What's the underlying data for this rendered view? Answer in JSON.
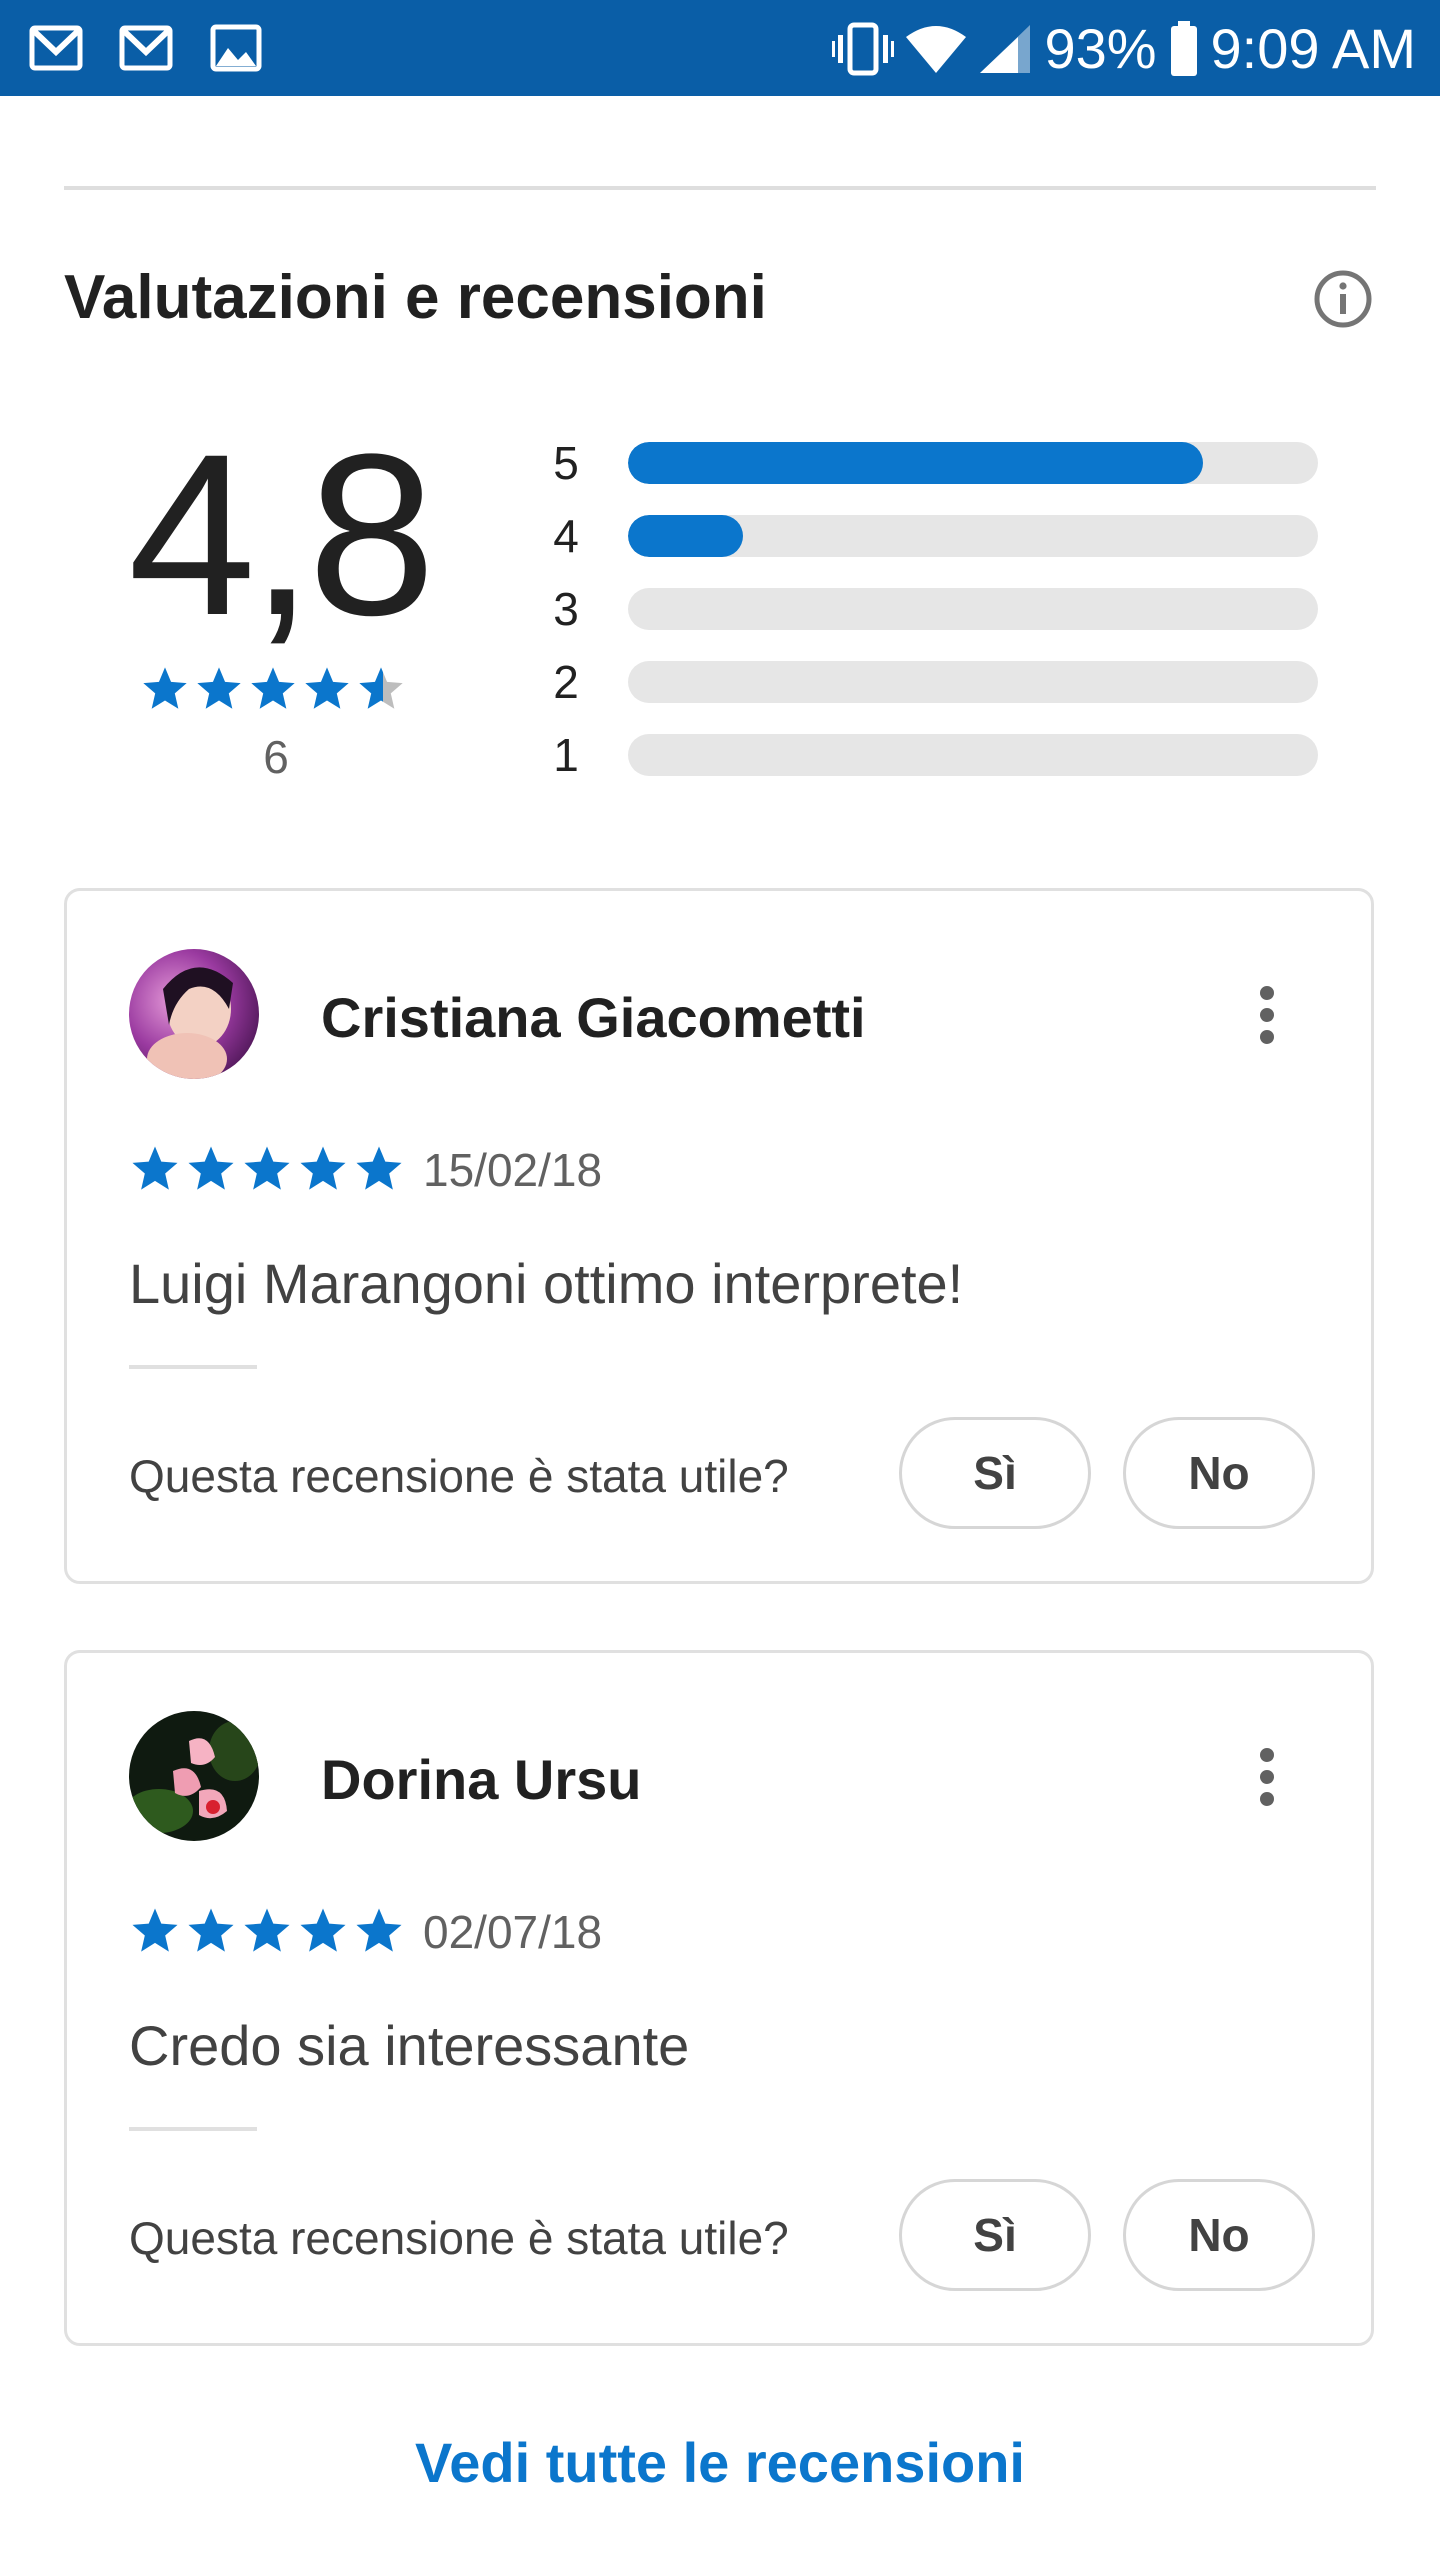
{
  "status_bar": {
    "left_icons": [
      "gmail-icon",
      "gmail-icon",
      "image-icon"
    ],
    "right_icons": [
      "vibrate-icon",
      "wifi-icon",
      "signal-icon",
      "battery-icon"
    ],
    "battery": "93%",
    "time": "9:09 AM"
  },
  "ratings": {
    "title": "Valutazioni e recensioni",
    "average": "4,8",
    "average_stars": 4.8,
    "count": "6",
    "histogram": [
      {
        "label": "5",
        "fraction": 0.833
      },
      {
        "label": "4",
        "fraction": 0.167
      },
      {
        "label": "3",
        "fraction": 0
      },
      {
        "label": "2",
        "fraction": 0
      },
      {
        "label": "1",
        "fraction": 0
      }
    ]
  },
  "reviews": [
    {
      "author": "Cristiana Giacometti",
      "stars": 5,
      "date": "15/02/18",
      "text": "Luigi Marangoni ottimo interprete!",
      "helpful_question": "Questa recensione è stata utile?",
      "yes_label": "Sì",
      "no_label": "No"
    },
    {
      "author": "Dorina Ursu",
      "stars": 5,
      "date": "02/07/18",
      "text": "Credo sia interessante",
      "helpful_question": "Questa recensione è stata utile?",
      "yes_label": "Sì",
      "no_label": "No"
    }
  ],
  "see_all_label": "Vedi tutte le recensioni",
  "colors": {
    "status_bar": "#0a5ea7",
    "accent": "#0b76cc",
    "star_empty": "#bdbdbd",
    "track": "#e6e6e6"
  }
}
